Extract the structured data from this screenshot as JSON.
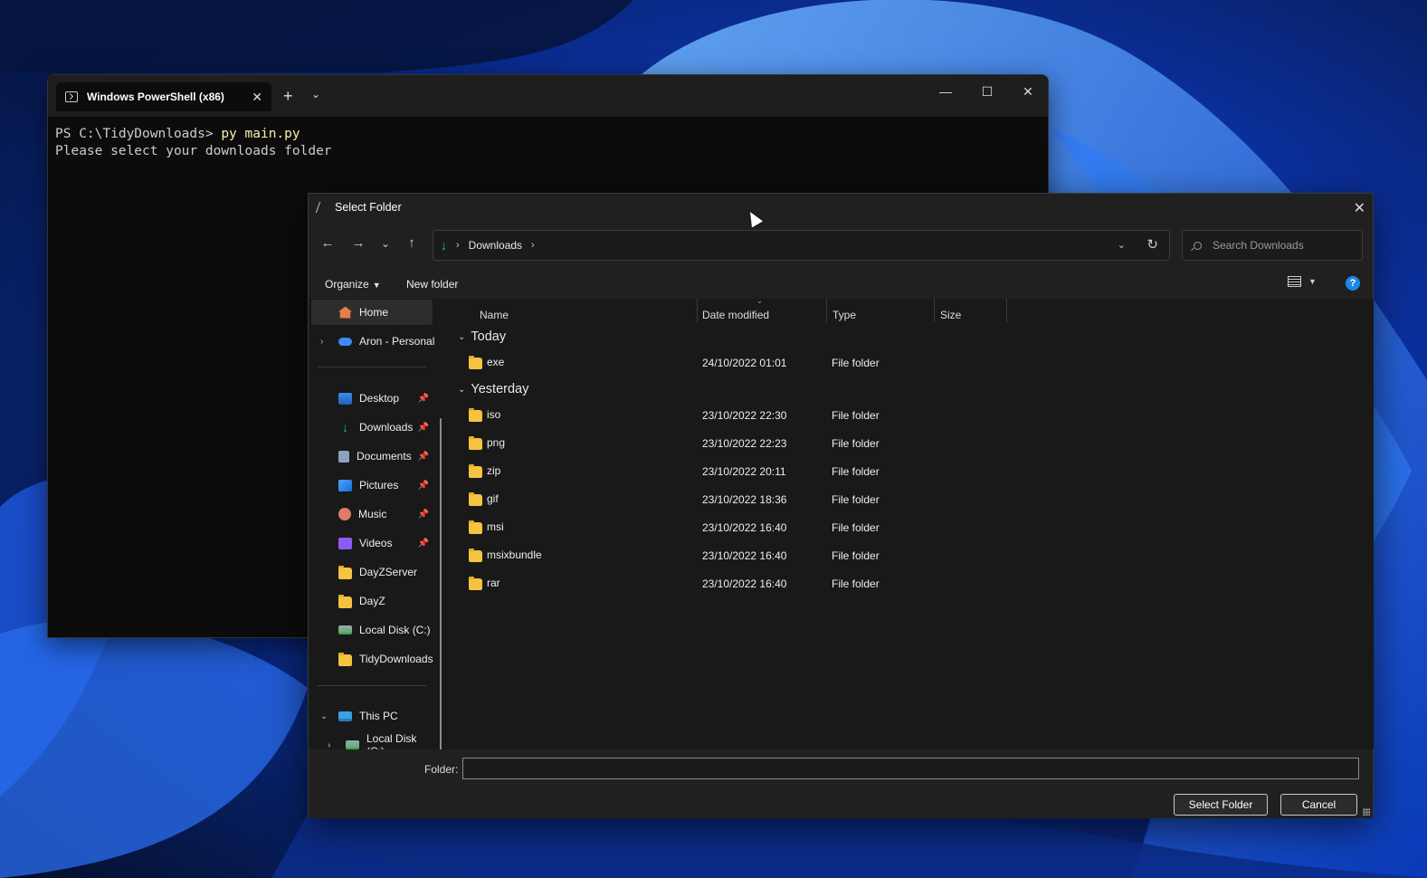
{
  "terminal": {
    "tab_title": "Windows PowerShell (x86)",
    "tab_close": "✕",
    "new_tab": "+",
    "dropdown": "⌄",
    "minimize": "—",
    "maximize": "☐",
    "close": "✕",
    "lines": [
      {
        "prompt": "PS C:\\TidyDownloads> ",
        "cmd": "py main.py"
      },
      {
        "prompt": "Please select your downloads folder",
        "cmd": ""
      }
    ]
  },
  "dialog": {
    "title": "Select Folder",
    "close": "✕",
    "nav": {
      "back": "←",
      "forward": "→",
      "recent": "⌄",
      "up": "↑"
    },
    "address": {
      "crumb": "Downloads",
      "sep": "›"
    },
    "search_placeholder": "Search Downloads",
    "toolbar": {
      "organize": "Organize",
      "new_folder": "New folder",
      "help": "?"
    },
    "nav_pane": {
      "home": "Home",
      "onedrive": "Aron - Personal",
      "quick": [
        {
          "label": "Desktop",
          "icon": "desktop-icon",
          "pinned": true
        },
        {
          "label": "Downloads",
          "icon": "download-icon",
          "pinned": true
        },
        {
          "label": "Documents",
          "icon": "documents-icon",
          "pinned": true
        },
        {
          "label": "Pictures",
          "icon": "pictures-icon",
          "pinned": true
        },
        {
          "label": "Music",
          "icon": "music-icon",
          "pinned": true
        },
        {
          "label": "Videos",
          "icon": "videos-icon",
          "pinned": true
        },
        {
          "label": "DayZServer",
          "icon": "folder-icon",
          "pinned": false
        },
        {
          "label": "DayZ",
          "icon": "folder-icon",
          "pinned": false
        },
        {
          "label": "Local Disk (C:)",
          "icon": "disk-icon",
          "pinned": false
        },
        {
          "label": "TidyDownloads",
          "icon": "folder-icon",
          "pinned": false
        }
      ],
      "this_pc": "This PC",
      "pc_child": "Local Disk (C:)"
    },
    "columns": {
      "name": "Name",
      "date": "Date modified",
      "type": "Type",
      "size": "Size"
    },
    "groups": [
      {
        "label": "Today",
        "rows": [
          {
            "name": "exe",
            "date": "24/10/2022 01:01",
            "type": "File folder"
          }
        ]
      },
      {
        "label": "Yesterday",
        "rows": [
          {
            "name": "iso",
            "date": "23/10/2022 22:30",
            "type": "File folder"
          },
          {
            "name": "png",
            "date": "23/10/2022 22:23",
            "type": "File folder"
          },
          {
            "name": "zip",
            "date": "23/10/2022 20:11",
            "type": "File folder"
          },
          {
            "name": "gif",
            "date": "23/10/2022 18:36",
            "type": "File folder"
          },
          {
            "name": "msi",
            "date": "23/10/2022 16:40",
            "type": "File folder"
          },
          {
            "name": "msixbundle",
            "date": "23/10/2022 16:40",
            "type": "File folder"
          },
          {
            "name": "rar",
            "date": "23/10/2022 16:40",
            "type": "File folder"
          }
        ]
      }
    ],
    "folder_label": "Folder:",
    "folder_value": "",
    "select_button": "Select Folder",
    "cancel_button": "Cancel"
  },
  "colors": {
    "accent": "#1e88e5",
    "folder": "#f4c33f",
    "download_green": "#22c55e"
  }
}
